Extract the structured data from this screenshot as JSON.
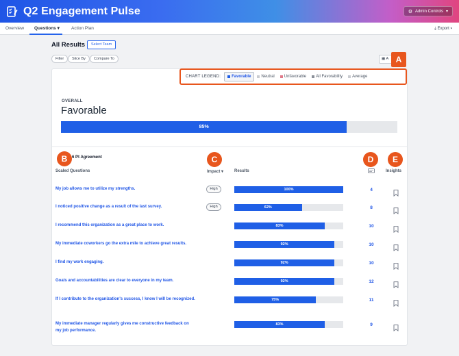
{
  "app": {
    "title": "Q2 Engagement Pulse",
    "admin_label": "Admin Controls"
  },
  "nav": {
    "tabs": [
      "Overview",
      "Questions",
      "Action Plan"
    ],
    "active": "Questions",
    "export_label": "Export"
  },
  "page": {
    "title": "All Results",
    "select_team": "Select Team"
  },
  "filters": [
    "Filter",
    "Slice By",
    "Compare To"
  ],
  "calendar_label": "A",
  "legend": {
    "title": "CHART LEGEND:",
    "items": [
      {
        "label": "Favorable",
        "color": "#1f5fe6",
        "selected": true
      },
      {
        "label": "Neutral",
        "color": "#c9ccd1",
        "selected": false
      },
      {
        "label": "Unfavorable",
        "color": "#e07a8a",
        "selected": false
      },
      {
        "label": "All Favorability",
        "color": "#8b9099",
        "selected": false
      },
      {
        "label": "Average",
        "color": "#c9ccd1",
        "selected": false
      }
    ]
  },
  "overall": {
    "label": "OVERALL",
    "value": "Favorable",
    "percent": 85,
    "percent_label": "85%"
  },
  "scale_label": "e: 6 Pt Agreement",
  "columns": {
    "questions": "Scaled Questions",
    "impact": "Impact",
    "results": "Results",
    "insights": "Insights"
  },
  "markers": [
    "A",
    "B",
    "C",
    "D",
    "E"
  ],
  "questions": [
    {
      "text": "My job allows me to utilize my strengths.",
      "impact": "High",
      "percent": 100,
      "label": "100%",
      "count": "4"
    },
    {
      "text": "I noticed positive change as a result of the last survey.",
      "impact": "High",
      "percent": 62,
      "label": "62%",
      "count": "8"
    },
    {
      "text": "I recommend this organization as a great place to work.",
      "impact": "",
      "percent": 83,
      "label": "83%",
      "count": "10"
    },
    {
      "text": "My immediate coworkers go the extra mile to achieve great results.",
      "impact": "",
      "percent": 92,
      "label": "92%",
      "count": "10"
    },
    {
      "text": "I find my work engaging.",
      "impact": "",
      "percent": 92,
      "label": "92%",
      "count": "10"
    },
    {
      "text": "Goals and accountabilities are clear to everyone in my team.",
      "impact": "",
      "percent": 92,
      "label": "92%",
      "count": "12"
    },
    {
      "text": "If I contribute to the organization's success, I know I will be recognized.",
      "impact": "",
      "percent": 75,
      "label": "75%",
      "count": "11"
    },
    {
      "text": "My immediate manager regularly gives me constructive feedback on my job performance.",
      "impact": "",
      "percent": 83,
      "label": "83%",
      "count": "9"
    }
  ]
}
